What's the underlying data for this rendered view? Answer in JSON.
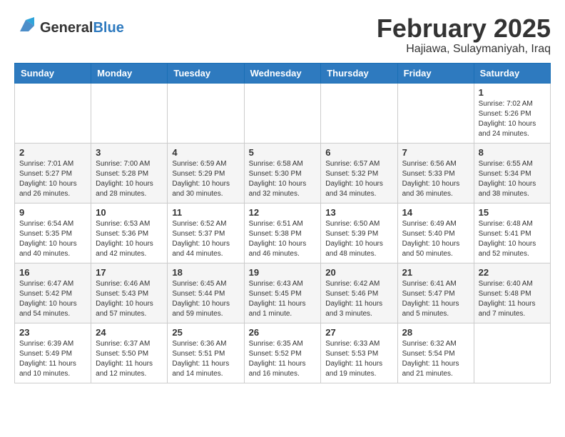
{
  "header": {
    "logo_general": "General",
    "logo_blue": "Blue",
    "month_title": "February 2025",
    "location": "Hajiawa, Sulaymaniyah, Iraq"
  },
  "weekdays": [
    "Sunday",
    "Monday",
    "Tuesday",
    "Wednesday",
    "Thursday",
    "Friday",
    "Saturday"
  ],
  "weeks": [
    [
      {
        "day": "",
        "info": ""
      },
      {
        "day": "",
        "info": ""
      },
      {
        "day": "",
        "info": ""
      },
      {
        "day": "",
        "info": ""
      },
      {
        "day": "",
        "info": ""
      },
      {
        "day": "",
        "info": ""
      },
      {
        "day": "1",
        "info": "Sunrise: 7:02 AM\nSunset: 5:26 PM\nDaylight: 10 hours and 24 minutes."
      }
    ],
    [
      {
        "day": "2",
        "info": "Sunrise: 7:01 AM\nSunset: 5:27 PM\nDaylight: 10 hours and 26 minutes."
      },
      {
        "day": "3",
        "info": "Sunrise: 7:00 AM\nSunset: 5:28 PM\nDaylight: 10 hours and 28 minutes."
      },
      {
        "day": "4",
        "info": "Sunrise: 6:59 AM\nSunset: 5:29 PM\nDaylight: 10 hours and 30 minutes."
      },
      {
        "day": "5",
        "info": "Sunrise: 6:58 AM\nSunset: 5:30 PM\nDaylight: 10 hours and 32 minutes."
      },
      {
        "day": "6",
        "info": "Sunrise: 6:57 AM\nSunset: 5:32 PM\nDaylight: 10 hours and 34 minutes."
      },
      {
        "day": "7",
        "info": "Sunrise: 6:56 AM\nSunset: 5:33 PM\nDaylight: 10 hours and 36 minutes."
      },
      {
        "day": "8",
        "info": "Sunrise: 6:55 AM\nSunset: 5:34 PM\nDaylight: 10 hours and 38 minutes."
      }
    ],
    [
      {
        "day": "9",
        "info": "Sunrise: 6:54 AM\nSunset: 5:35 PM\nDaylight: 10 hours and 40 minutes."
      },
      {
        "day": "10",
        "info": "Sunrise: 6:53 AM\nSunset: 5:36 PM\nDaylight: 10 hours and 42 minutes."
      },
      {
        "day": "11",
        "info": "Sunrise: 6:52 AM\nSunset: 5:37 PM\nDaylight: 10 hours and 44 minutes."
      },
      {
        "day": "12",
        "info": "Sunrise: 6:51 AM\nSunset: 5:38 PM\nDaylight: 10 hours and 46 minutes."
      },
      {
        "day": "13",
        "info": "Sunrise: 6:50 AM\nSunset: 5:39 PM\nDaylight: 10 hours and 48 minutes."
      },
      {
        "day": "14",
        "info": "Sunrise: 6:49 AM\nSunset: 5:40 PM\nDaylight: 10 hours and 50 minutes."
      },
      {
        "day": "15",
        "info": "Sunrise: 6:48 AM\nSunset: 5:41 PM\nDaylight: 10 hours and 52 minutes."
      }
    ],
    [
      {
        "day": "16",
        "info": "Sunrise: 6:47 AM\nSunset: 5:42 PM\nDaylight: 10 hours and 54 minutes."
      },
      {
        "day": "17",
        "info": "Sunrise: 6:46 AM\nSunset: 5:43 PM\nDaylight: 10 hours and 57 minutes."
      },
      {
        "day": "18",
        "info": "Sunrise: 6:45 AM\nSunset: 5:44 PM\nDaylight: 10 hours and 59 minutes."
      },
      {
        "day": "19",
        "info": "Sunrise: 6:43 AM\nSunset: 5:45 PM\nDaylight: 11 hours and 1 minute."
      },
      {
        "day": "20",
        "info": "Sunrise: 6:42 AM\nSunset: 5:46 PM\nDaylight: 11 hours and 3 minutes."
      },
      {
        "day": "21",
        "info": "Sunrise: 6:41 AM\nSunset: 5:47 PM\nDaylight: 11 hours and 5 minutes."
      },
      {
        "day": "22",
        "info": "Sunrise: 6:40 AM\nSunset: 5:48 PM\nDaylight: 11 hours and 7 minutes."
      }
    ],
    [
      {
        "day": "23",
        "info": "Sunrise: 6:39 AM\nSunset: 5:49 PM\nDaylight: 11 hours and 10 minutes."
      },
      {
        "day": "24",
        "info": "Sunrise: 6:37 AM\nSunset: 5:50 PM\nDaylight: 11 hours and 12 minutes."
      },
      {
        "day": "25",
        "info": "Sunrise: 6:36 AM\nSunset: 5:51 PM\nDaylight: 11 hours and 14 minutes."
      },
      {
        "day": "26",
        "info": "Sunrise: 6:35 AM\nSunset: 5:52 PM\nDaylight: 11 hours and 16 minutes."
      },
      {
        "day": "27",
        "info": "Sunrise: 6:33 AM\nSunset: 5:53 PM\nDaylight: 11 hours and 19 minutes."
      },
      {
        "day": "28",
        "info": "Sunrise: 6:32 AM\nSunset: 5:54 PM\nDaylight: 11 hours and 21 minutes."
      },
      {
        "day": "",
        "info": ""
      }
    ]
  ]
}
